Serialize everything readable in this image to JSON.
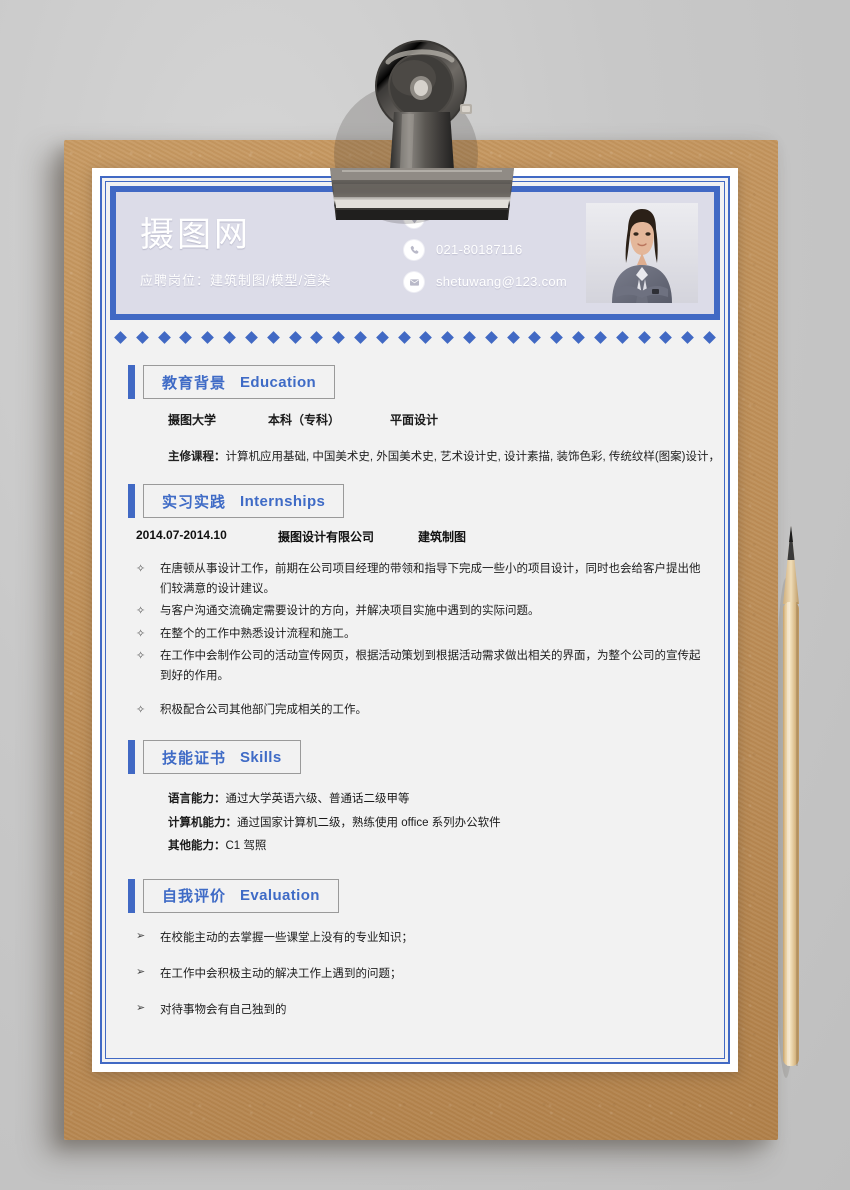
{
  "document": {
    "type": "resume-template",
    "accent_color": "#4169c4",
    "header_bg": "#dcdce8",
    "paper_bg": "#f2f2f2",
    "clipboard_color": "#bf9059",
    "backdrop_color": "#c9c9c9"
  },
  "header": {
    "name": "摄图网",
    "position_label": "应聘岗位：",
    "position_value": "建筑制图/模型/渲染",
    "position_line": "应聘岗位：建筑制图/模型/渲染",
    "contacts": [
      {
        "icon": "location-icon",
        "value": ""
      },
      {
        "icon": "phone-icon",
        "value": "021-80187116"
      },
      {
        "icon": "email-icon",
        "value": "shetuwang@123.com"
      }
    ],
    "photo_alt": "portrait-photo"
  },
  "sections": [
    {
      "id": "education",
      "title_cn": "教育背景",
      "title_en": "Education",
      "entry": {
        "school": "摄图大学",
        "degree": "本科（专科）",
        "major": "平面设计"
      },
      "course_label": "主修课程：",
      "course_value": "计算机应用基础, 中国美术史, 外国美术史, 艺术设计史, 设计素描, 装饰色彩, 传统纹样(图案)设计，"
    },
    {
      "id": "internships",
      "title_cn": "实习实践",
      "title_en": "Internships",
      "entry": {
        "period": "2014.07-2014.10",
        "company": "摄图设计有限公司",
        "role": "建筑制图"
      },
      "bullet_mark": "✧",
      "bullets": [
        "在唐顿从事设计工作，前期在公司项目经理的带领和指导下完成一些小的项目设计，同时也会给客户提出他们较满意的设计建议。",
        "与客户沟通交流确定需要设计的方向，并解决项目实施中遇到的实际问题。",
        "在整个的工作中熟悉设计流程和施工。",
        "在工作中会制作公司的活动宣传网页，根据活动策划到根据活动需求做出相关的界面，为整个公司的宣传起到好的作用。",
        "积极配合公司其他部门完成相关的工作。"
      ]
    },
    {
      "id": "skills",
      "title_cn": "技能证书",
      "title_en": "Skills",
      "items": [
        {
          "label": "语言能力：",
          "value": "通过大学英语六级、普通话二级甲等"
        },
        {
          "label": "计算机能力：",
          "value": "通过国家计算机二级，熟练使用 office 系列办公软件"
        },
        {
          "label": "其他能力：",
          "value": "C1 驾照"
        }
      ]
    },
    {
      "id": "evaluation",
      "title_cn": "自我评价",
      "title_en": "Evaluation",
      "bullet_mark": "➢",
      "bullets": [
        "在校能主动的去掌握一些课堂上没有的专业知识；",
        "在工作中会积极主动的解决工作上遇到的问题；",
        "对待事物会有自己独到的"
      ]
    }
  ],
  "decor": {
    "diamond_count": 28,
    "diamond_color": "#4169c4",
    "clip": "binder-clip",
    "pencil": "wooden-pencil"
  }
}
